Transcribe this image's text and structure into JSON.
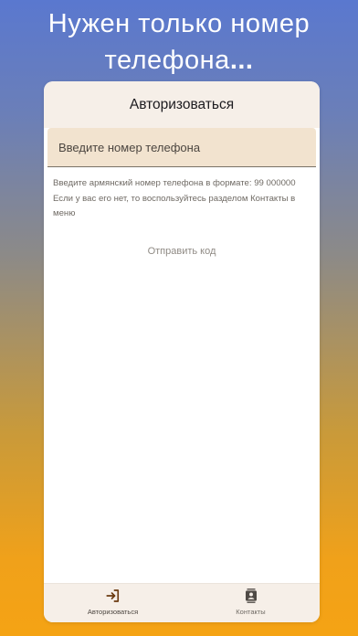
{
  "promo": {
    "line1": "Нужен только номер",
    "line2": "телефона",
    "dots": "..."
  },
  "app": {
    "title": "Авторизоваться",
    "phone_field": {
      "placeholder": "Введите номер телефона",
      "value": ""
    },
    "hint_line1": "Введите армянский номер телефона в формате: 99 000000",
    "hint_line2": "Если у вас его нет, то воспользуйтесь разделом Контакты в меню",
    "send_button": "Отправить код",
    "bottom_nav": [
      {
        "label": "Авторизоваться",
        "icon": "login-icon",
        "active": true
      },
      {
        "label": "Контакты",
        "icon": "contacts-icon",
        "active": false
      }
    ]
  },
  "colors": {
    "accent": "#6b3a10",
    "field_bg": "#f2e3cf",
    "bar_bg": "#f6efe8"
  }
}
